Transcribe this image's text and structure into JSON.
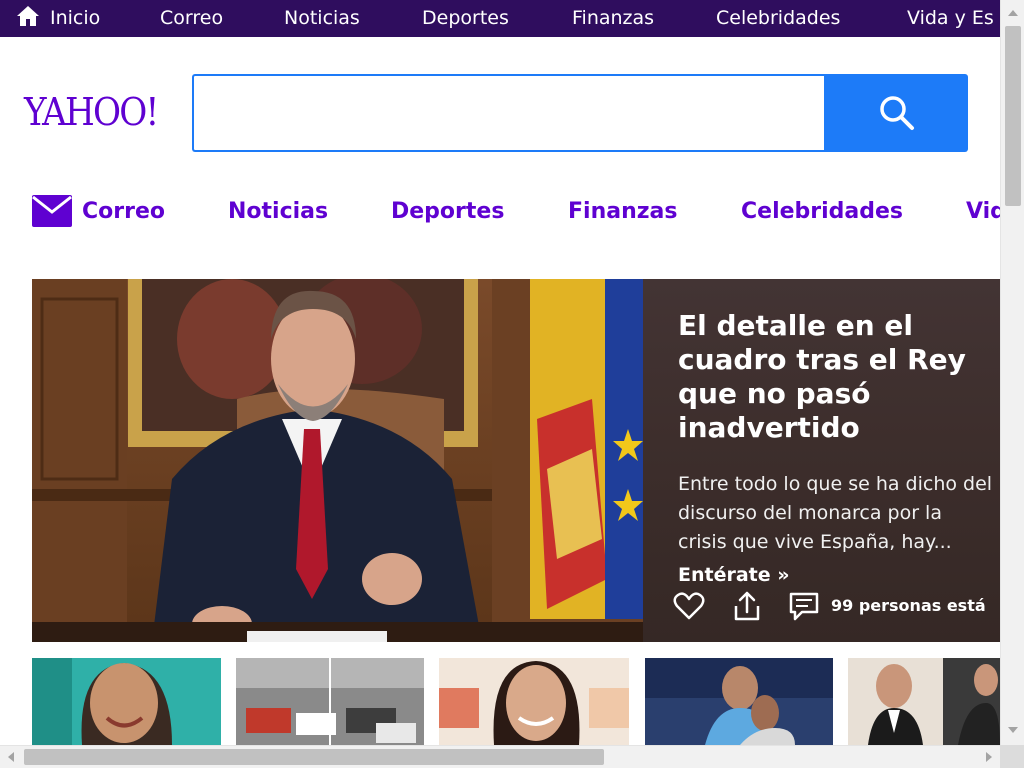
{
  "topnav": {
    "items": [
      "Inicio",
      "Correo",
      "Noticias",
      "Deportes",
      "Finanzas",
      "Celebridades",
      "Vida y Es"
    ],
    "home_icon": "home-icon"
  },
  "brand": {
    "logo_text": "YAHOO!",
    "color": "#5f01d1"
  },
  "search": {
    "value": "",
    "placeholder": "",
    "button_icon": "search-icon",
    "accent": "#1d7bf8"
  },
  "subnav": {
    "items": [
      "Correo",
      "Noticias",
      "Deportes",
      "Finanzas",
      "Celebridades",
      "Vid"
    ],
    "mail_icon": "mail-icon"
  },
  "hero": {
    "title": "El detalle en el cuadro tras el Rey que no pasó inadvertido",
    "summary": "Entre todo lo que se ha dicho del discurso del monarca por la crisis que vive España, hay...",
    "cta": "Entérate »",
    "comments": "99 personas está",
    "icons": [
      "heart-icon",
      "share-icon",
      "comment-icon"
    ]
  },
  "thumbnails": [
    "thumbnail-1",
    "thumbnail-2",
    "thumbnail-3",
    "thumbnail-4",
    "thumbnail-5"
  ],
  "colors": {
    "topbar_bg": "#2f0d5e",
    "link_purple": "#5f01d1",
    "panel_bg": "#3d2e2c"
  }
}
